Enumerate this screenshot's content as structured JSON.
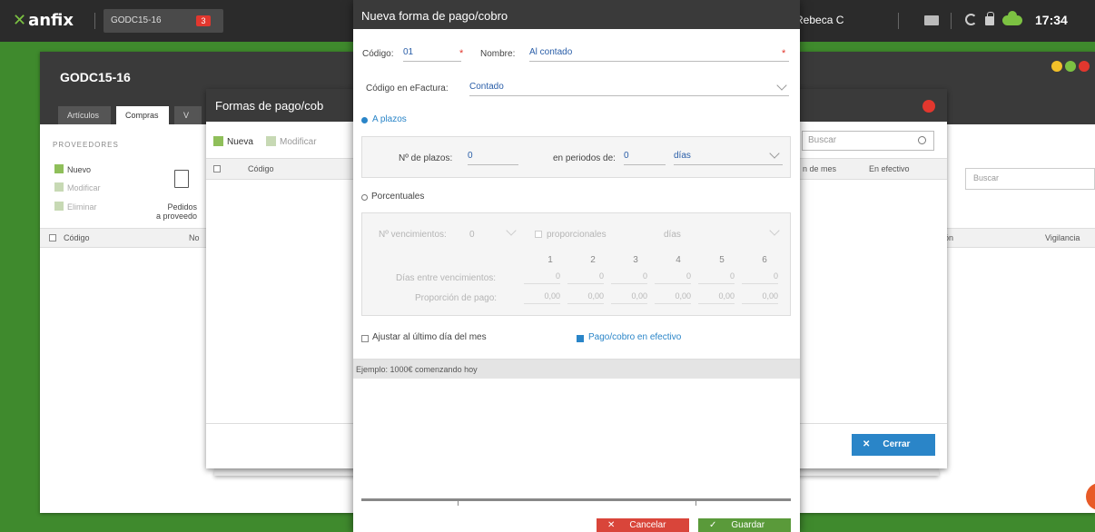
{
  "topbar": {
    "logo": "anfix",
    "company_tab": "GODC15-16",
    "company_badge": "3",
    "user_name": "Rebeca C",
    "clock": "17:34"
  },
  "bg_window": {
    "title": "GODC15-16",
    "tabs": [
      "Artículos",
      "Compras",
      "V"
    ],
    "section_label": "PROVEEDORES",
    "actions": [
      "Nuevo",
      "Modificar",
      "Eliminar"
    ],
    "pedidos_label": "Pedidos\na proveedo",
    "table_headers": [
      "Código",
      "No",
      "ón",
      "Vigilancia"
    ],
    "search_placeholder": "Buscar"
  },
  "formas_window": {
    "title": "Formas de pago/cob",
    "toolbar": {
      "nueva": "Nueva",
      "modificar": "Modificar"
    },
    "search_placeholder": "Buscar",
    "table_headers": [
      "Código",
      "n de mes",
      "En efectivo"
    ],
    "close_label": "Cerrar"
  },
  "dialog": {
    "title": "Nueva forma de pago/cobro",
    "codigo_label": "Código:",
    "codigo_value": "01",
    "nombre_label": "Nombre:",
    "nombre_value": "Al contado",
    "efactura_label": "Código en eFactura:",
    "efactura_value": "Contado",
    "a_plazos_label": "A plazos",
    "n_plazos_label": "Nº de plazos:",
    "n_plazos_value": "0",
    "periodos_label": "en periodos de:",
    "periodos_value": "0",
    "periodo_unit": "días",
    "porcentuales_label": "Porcentuales",
    "n_vencimientos_label": "Nº vencimientos:",
    "n_vencimientos_value": "0",
    "proporcionales_label": "proporcionales",
    "porc_unit": "días",
    "col_numbers": [
      "1",
      "2",
      "3",
      "4",
      "5",
      "6"
    ],
    "dias_entre_label": "Días entre vencimientos:",
    "dias_entre_values": [
      "0",
      "0",
      "0",
      "0",
      "0",
      "0"
    ],
    "proporcion_label": "Proporción de pago:",
    "proporcion_values": [
      "0,00",
      "0,00",
      "0,00",
      "0,00",
      "0,00",
      "0,00"
    ],
    "ajustar_label": "Ajustar al último día del mes",
    "efectivo_label": "Pago/cobro en efectivo",
    "example_text": "Ejemplo: 1000€ comenzando hoy",
    "cancel_label": "Cancelar",
    "save_label": "Guardar"
  },
  "colors": {
    "accent_blue": "#2a85c8",
    "brand_green": "#7cc242",
    "danger_red": "#d9453a",
    "save_green": "#5a9a3a"
  }
}
